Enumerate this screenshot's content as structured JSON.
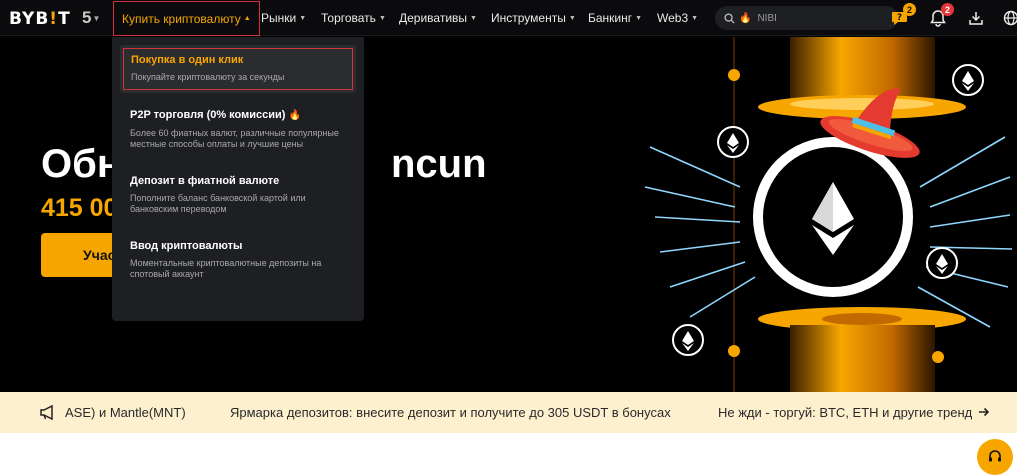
{
  "header": {
    "logo_main": "BYB",
    "logo_accent": "!",
    "logo_end": "T",
    "anniversary": "5",
    "nav": [
      {
        "label": "Купить криптовалюту"
      },
      {
        "label": "Рынки"
      },
      {
        "label": "Торговать"
      },
      {
        "label": "Деривативы"
      },
      {
        "label": "Инструменты"
      },
      {
        "label": "Банкинг"
      },
      {
        "label": "Web3"
      }
    ],
    "search_placeholder": "NIBI",
    "gift_count": "2",
    "notif_count": "2"
  },
  "dropdown": {
    "items": [
      {
        "title": "Покупка в один клик",
        "desc": "Покупайте криптовалюту за секунды"
      },
      {
        "title": "P2P торговля (0% комиссии)",
        "desc": "Более 60 фиатных валют, различные популярные местные способы оплаты и лучшие цены"
      },
      {
        "title": "Депозит в фиатной валюте",
        "desc": "Пополните баланс банковской картой или банковским переводом"
      },
      {
        "title": "Ввод криптовалюты",
        "desc": "Моментальные криптовалютные депозиты на спотовый аккаунт"
      }
    ]
  },
  "hero": {
    "title_left": "Обн",
    "title_right": "ncun",
    "amount": "415 00",
    "cta_label": "Учас"
  },
  "ticker": {
    "item1": "ASE) и Mantle(MNT)",
    "item2": "Ярмарка депозитов: внесите депозит и получите до 305 USDT в бонусах",
    "item3": "Не жди - торгуй: BTC, ETH и другие тренд"
  },
  "colors": {
    "accent": "#f7a600",
    "highlight_border": "#d2323c",
    "dropdown_bg": "#1e1f22",
    "ticker_bg": "#fdf0cf"
  }
}
